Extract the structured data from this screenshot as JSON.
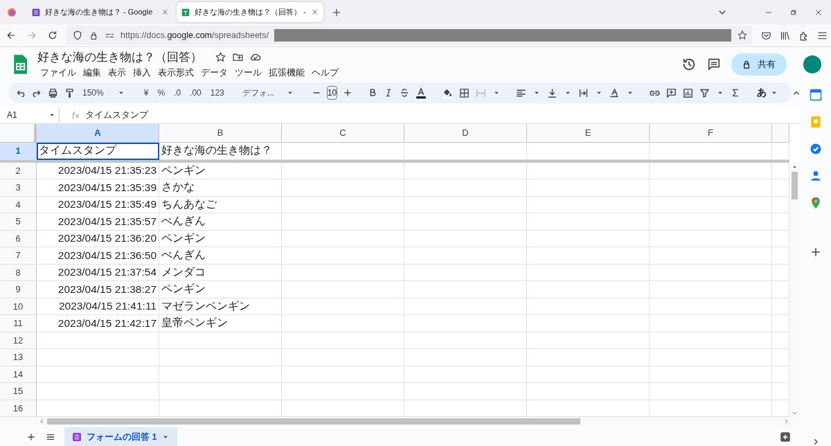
{
  "browser": {
    "tabs": [
      {
        "title": "好きな海の生き物は？ - Google",
        "selected": false
      },
      {
        "title": "好きな海の生き物は？（回答） -",
        "selected": true
      }
    ],
    "url_prefix": "https://docs.",
    "url_domain": "google.com",
    "url_path": "/spreadsheets/"
  },
  "doc": {
    "title": "好きな海の生き物は？（回答）",
    "menu": [
      "ファイル",
      "編集",
      "表示",
      "挿入",
      "表示形式",
      "データ",
      "ツール",
      "拡張機能",
      "ヘルプ"
    ],
    "share": "共有"
  },
  "toolbar": {
    "zoom": "150%",
    "currency": "¥",
    "percent": "%",
    "dec_decrease": ".0",
    "dec_increase": ".00",
    "number_format": "123",
    "font": "デフォ...",
    "font_size": "10",
    "input_mode": "あ"
  },
  "formula_bar": {
    "cell_ref": "A1",
    "content": "タイムスタンプ"
  },
  "columns": [
    {
      "label": "A",
      "selected": true
    },
    {
      "label": "B",
      "selected": false
    },
    {
      "label": "C",
      "selected": false
    },
    {
      "label": "D",
      "selected": false
    },
    {
      "label": "E",
      "selected": false
    },
    {
      "label": "F",
      "selected": false
    }
  ],
  "rows": [
    {
      "number": "1",
      "selected": true,
      "cells": [
        {
          "text": "タイムスタンプ",
          "kind": "text",
          "selected": true
        },
        {
          "text": "好きな海の生き物は？",
          "kind": "text",
          "selected": false
        }
      ]
    },
    {
      "number": "2",
      "selected": false,
      "cells": [
        {
          "text": "2023/04/15 21:35:23",
          "kind": "date",
          "selected": false
        },
        {
          "text": "ペンギン",
          "kind": "text",
          "selected": false
        }
      ]
    },
    {
      "number": "3",
      "selected": false,
      "cells": [
        {
          "text": "2023/04/15 21:35:39",
          "kind": "date",
          "selected": false
        },
        {
          "text": "さかな",
          "kind": "text",
          "selected": false
        }
      ]
    },
    {
      "number": "4",
      "selected": false,
      "cells": [
        {
          "text": "2023/04/15 21:35:49",
          "kind": "date",
          "selected": false
        },
        {
          "text": "ちんあなご",
          "kind": "text",
          "selected": false
        }
      ]
    },
    {
      "number": "5",
      "selected": false,
      "cells": [
        {
          "text": "2023/04/15 21:35:57",
          "kind": "date",
          "selected": false
        },
        {
          "text": "ぺんぎん",
          "kind": "text",
          "selected": false
        }
      ]
    },
    {
      "number": "6",
      "selected": false,
      "cells": [
        {
          "text": "2023/04/15 21:36:20",
          "kind": "date",
          "selected": false
        },
        {
          "text": "ペンギン",
          "kind": "text",
          "selected": false
        }
      ]
    },
    {
      "number": "7",
      "selected": false,
      "cells": [
        {
          "text": "2023/04/15 21:36:50",
          "kind": "date",
          "selected": false
        },
        {
          "text": "ぺんぎん",
          "kind": "text",
          "selected": false
        }
      ]
    },
    {
      "number": "8",
      "selected": false,
      "cells": [
        {
          "text": "2023/04/15 21:37:54",
          "kind": "date",
          "selected": false
        },
        {
          "text": "メンダコ",
          "kind": "text",
          "selected": false
        }
      ]
    },
    {
      "number": "9",
      "selected": false,
      "cells": [
        {
          "text": "2023/04/15 21:38:27",
          "kind": "date",
          "selected": false
        },
        {
          "text": "ペンギン",
          "kind": "text",
          "selected": false
        }
      ]
    },
    {
      "number": "10",
      "selected": false,
      "cells": [
        {
          "text": "2023/04/15 21:41:11",
          "kind": "date",
          "selected": false
        },
        {
          "text": "マゼランペンギン",
          "kind": "text",
          "selected": false
        }
      ]
    },
    {
      "number": "11",
      "selected": false,
      "cells": [
        {
          "text": "2023/04/15 21:42:17",
          "kind": "date",
          "selected": false
        },
        {
          "text": "皇帝ペンギン",
          "kind": "text",
          "selected": false
        }
      ]
    },
    {
      "number": "12",
      "selected": false,
      "cells": []
    },
    {
      "number": "13",
      "selected": false,
      "cells": []
    },
    {
      "number": "14",
      "selected": false,
      "cells": []
    },
    {
      "number": "15",
      "selected": false,
      "cells": []
    },
    {
      "number": "16",
      "selected": false,
      "cells": []
    }
  ],
  "sheet_tab": {
    "label": "フォームの回答 1",
    "selected": true
  }
}
